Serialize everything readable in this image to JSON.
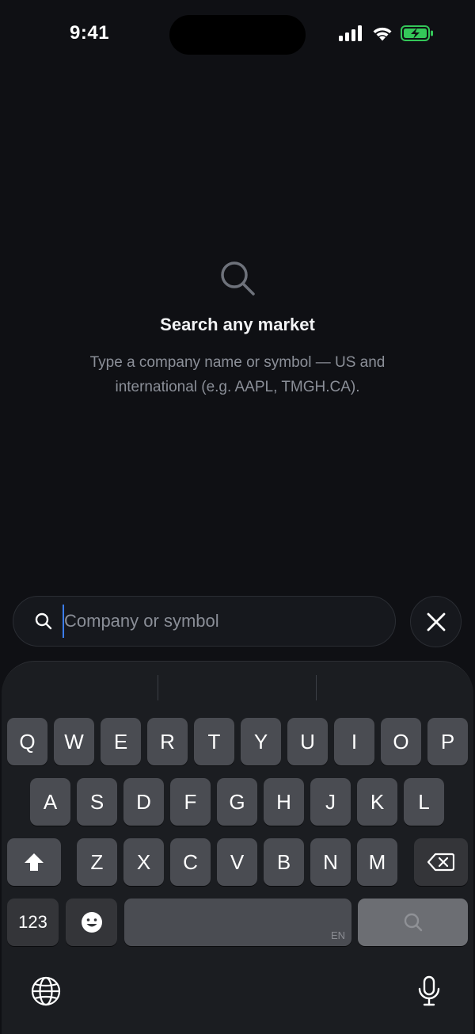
{
  "status_bar": {
    "time": "9:41",
    "icons": [
      "signal-icon",
      "wifi-icon",
      "battery-charging-icon"
    ],
    "battery_color": "#34c759"
  },
  "empty_state": {
    "icon": "search-icon",
    "title": "Search any market",
    "subtitle": "Type a company name or symbol — US and international (e.g. AAPL, TMGH.CA)."
  },
  "search": {
    "icon": "search-icon",
    "value": "",
    "placeholder": "Company or symbol",
    "close_icon": "close-icon"
  },
  "keyboard": {
    "row1": [
      "Q",
      "W",
      "E",
      "R",
      "T",
      "Y",
      "U",
      "I",
      "O",
      "P"
    ],
    "row2": [
      "A",
      "S",
      "D",
      "F",
      "G",
      "H",
      "J",
      "K",
      "L"
    ],
    "row3": [
      "Z",
      "X",
      "C",
      "V",
      "B",
      "N",
      "M"
    ],
    "numbers_label": "123",
    "space_language": "EN",
    "shift_icon": "shift-icon",
    "delete_icon": "delete-icon",
    "emoji_icon": "emoji-icon",
    "search_key_icon": "search-icon",
    "globe_icon": "globe-icon",
    "mic_icon": "microphone-icon"
  },
  "colors": {
    "background": "#0f1014",
    "key": "#4a4c52",
    "key_dark": "#343539",
    "cursor": "#3b7ded"
  }
}
